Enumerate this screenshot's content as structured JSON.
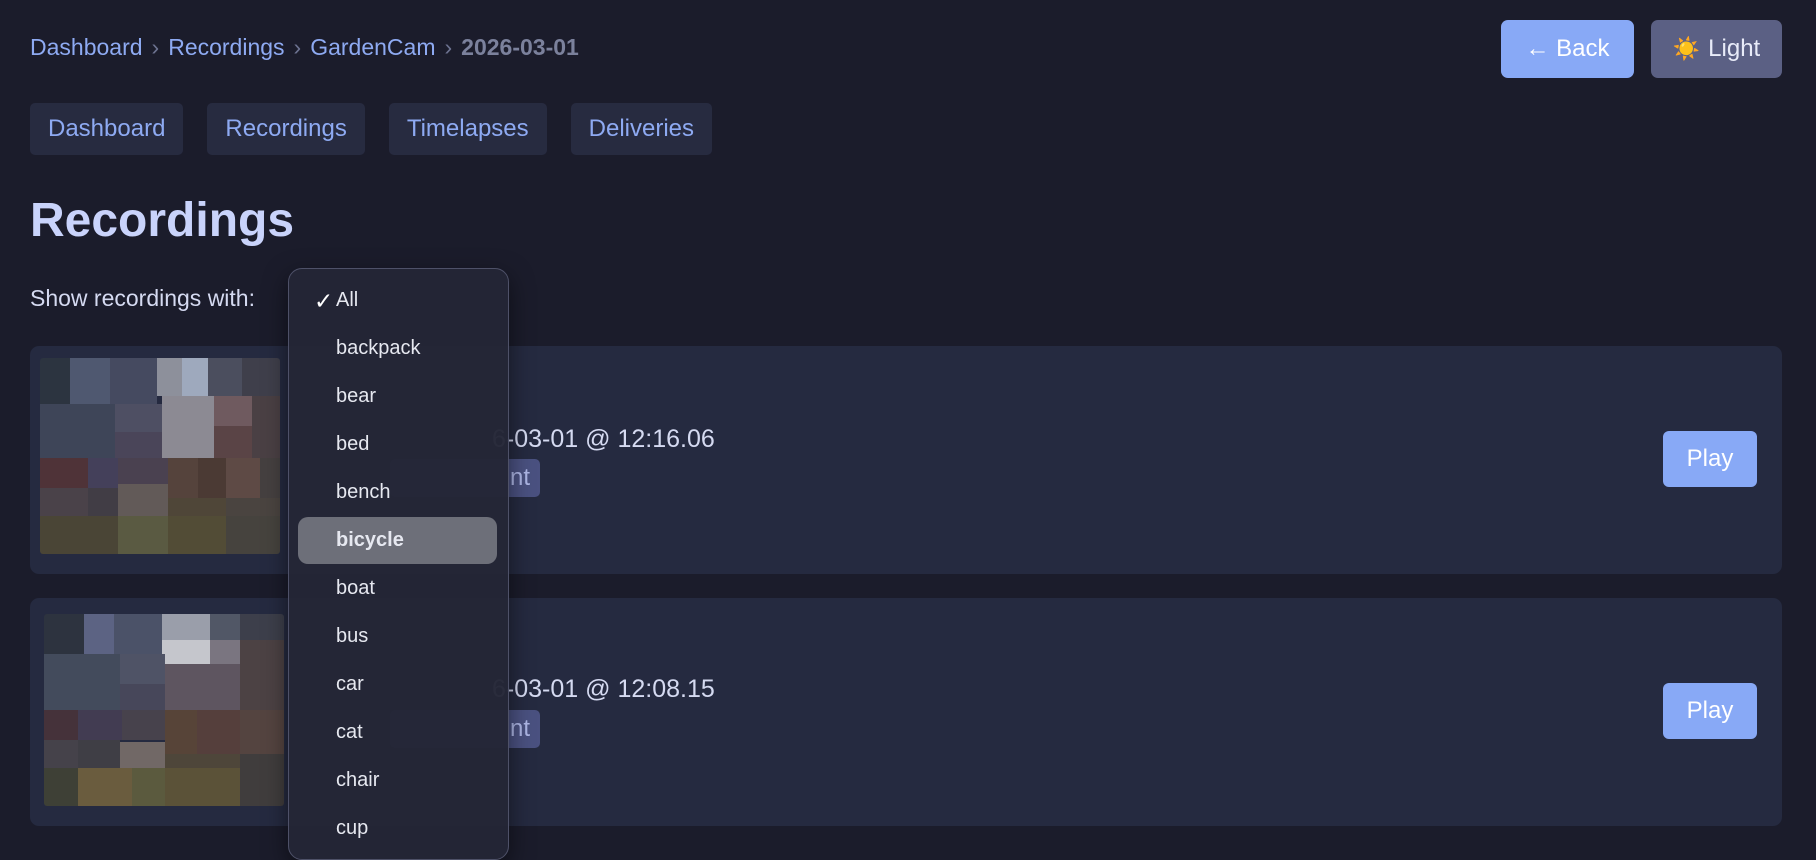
{
  "breadcrumb": {
    "items": [
      "Dashboard",
      "Recordings",
      "GardenCam"
    ],
    "separator": "›",
    "current": "2026-03-01"
  },
  "header": {
    "back_label": "← Back",
    "theme_icon": "☀️",
    "theme_label": "Light"
  },
  "nav": {
    "tabs": [
      "Dashboard",
      "Recordings",
      "Timelapses",
      "Deliveries"
    ]
  },
  "page": {
    "title": "Recordings"
  },
  "filter": {
    "label": "Show recordings with:",
    "check_glyph": "✓",
    "selected": "All",
    "highlighted": "bicycle",
    "options": [
      "All",
      "backpack",
      "bear",
      "bed",
      "bench",
      "bicycle",
      "boat",
      "bus",
      "car",
      "cat",
      "chair",
      "cup"
    ]
  },
  "recordings": [
    {
      "time_visible": "6-03-01 @ 12:16.06",
      "badge_visible": "nt",
      "play_label": "Play"
    },
    {
      "time_visible": "6-03-01 @ 12:08.15",
      "badge_visible": "nt",
      "play_label": "Play"
    }
  ],
  "colors": {
    "background": "#1b1c2b",
    "accent": "#88a9f6",
    "link": "#8eaaf2",
    "card": "#252a40",
    "badge": "#4a5180",
    "highlight": "#6d6f79"
  }
}
